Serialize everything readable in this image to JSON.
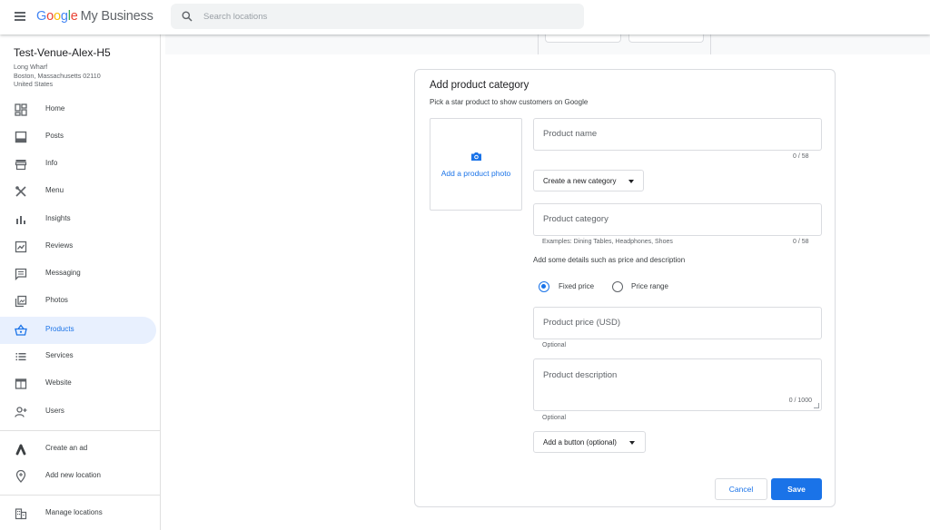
{
  "header": {
    "brand_letters": [
      "G",
      "o",
      "o",
      "g",
      "l",
      "e"
    ],
    "brand_suffix": "My Business",
    "search_placeholder": "Search locations"
  },
  "sidebar": {
    "business_name": "Test-Venue-Alex-H5",
    "address_line1": "Long Wharf",
    "address_line2": "Boston, Massachusetts 02110",
    "address_line3": "United States",
    "items": [
      {
        "label": "Home",
        "icon": "dashboard-icon"
      },
      {
        "label": "Posts",
        "icon": "posts-icon"
      },
      {
        "label": "Info",
        "icon": "storefront-icon"
      },
      {
        "label": "Menu",
        "icon": "utensils-icon"
      },
      {
        "label": "Insights",
        "icon": "bar-chart-icon"
      },
      {
        "label": "Reviews",
        "icon": "reviews-icon"
      },
      {
        "label": "Messaging",
        "icon": "chat-icon"
      },
      {
        "label": "Photos",
        "icon": "photos-icon"
      },
      {
        "label": "Products",
        "icon": "basket-icon"
      },
      {
        "label": "Services",
        "icon": "list-icon"
      },
      {
        "label": "Website",
        "icon": "website-icon"
      },
      {
        "label": "Users",
        "icon": "add-user-icon"
      }
    ],
    "secondary_items": [
      {
        "label": "Create an ad",
        "icon": "google-ads-icon"
      },
      {
        "label": "Add new location",
        "icon": "location-pin-icon"
      }
    ],
    "footer_item": {
      "label": "Manage locations",
      "icon": "buildings-icon"
    },
    "active_item": "Products"
  },
  "form": {
    "title": "Add product category",
    "subtitle": "Pick a star product to show customers on Google",
    "photo_label": "Add a product photo",
    "product_name_placeholder": "Product name",
    "product_name_counter": "0 / 58",
    "category_dropdown_label": "Create a new category",
    "product_category_placeholder": "Product category",
    "category_examples": "Examples: Dining Tables, Headphones, Shoes",
    "category_counter": "0 / 58",
    "details_text": "Add some details such as price and description",
    "price_options": [
      {
        "label": "Fixed price",
        "selected": true
      },
      {
        "label": "Price range",
        "selected": false
      }
    ],
    "price_placeholder": "Product price (USD)",
    "price_helper": "Optional",
    "description_placeholder": "Product description",
    "description_counter": "0 / 1000",
    "description_helper": "Optional",
    "button_dropdown_label": "Add a button (optional)",
    "cancel_label": "Cancel",
    "save_label": "Save"
  },
  "colors": {
    "accent": "#1a73e8",
    "active_bg": "#e8f0fe",
    "border": "#dadce0",
    "text_secondary": "#5f6368"
  }
}
